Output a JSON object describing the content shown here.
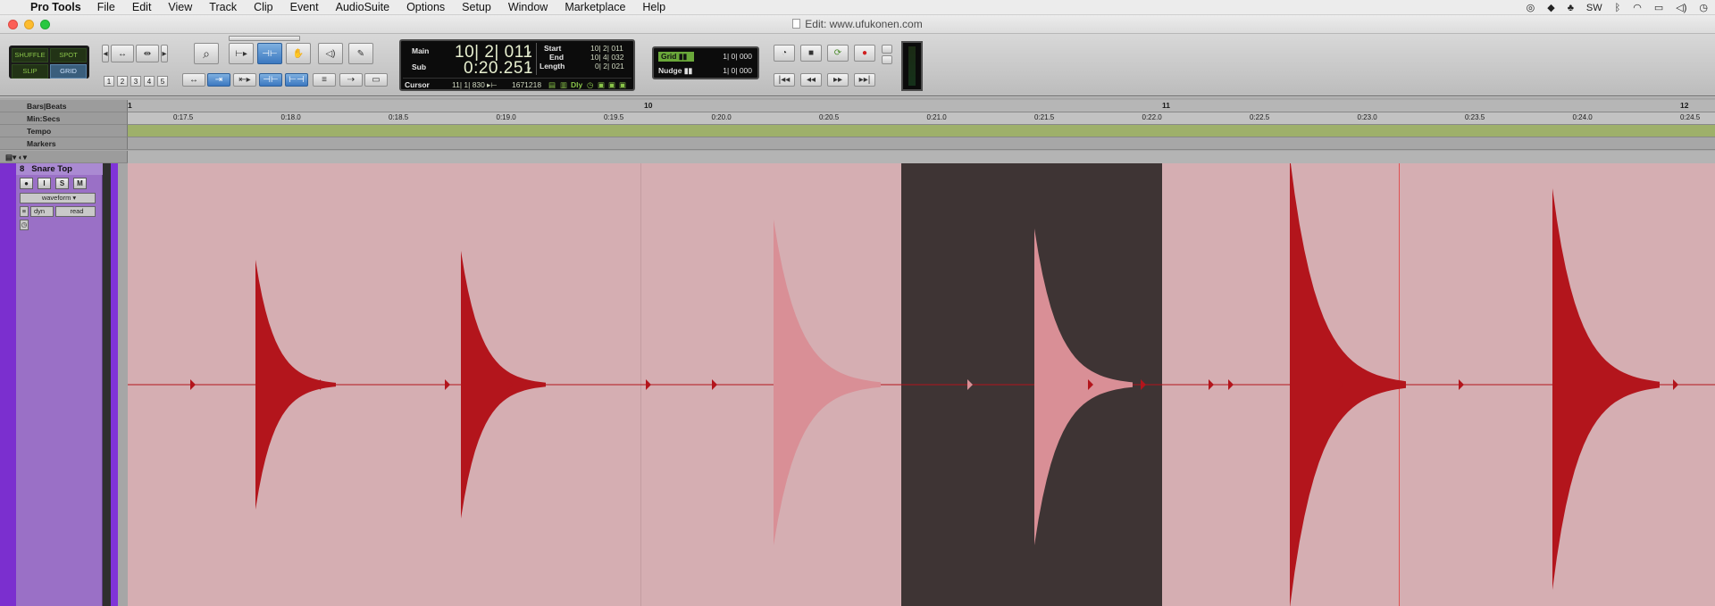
{
  "menubar": {
    "app_name": "Pro Tools",
    "items": [
      "File",
      "Edit",
      "View",
      "Track",
      "Clip",
      "Event",
      "AudioSuite",
      "Options",
      "Setup",
      "Window",
      "Marketplace",
      "Help"
    ],
    "status_text": "SW"
  },
  "window": {
    "title": "Edit: www.ufukonen.com"
  },
  "modes": {
    "shuffle": "SHUFFLE",
    "spot": "SPOT",
    "slip": "SLIP",
    "grid": "GRID"
  },
  "zoom_presets": [
    "1",
    "2",
    "3",
    "4",
    "5"
  ],
  "counter": {
    "main_label": "Main",
    "main_value": "10| 2| 011",
    "sub_label": "Sub",
    "sub_value": "0:20.251",
    "start_label": "Start",
    "start_value": "10| 2| 011",
    "end_label": "End",
    "end_value": "10| 4| 032",
    "length_label": "Length",
    "length_value": "0| 2| 021",
    "cursor_label": "Cursor",
    "cursor_value": "11| 1| 830",
    "sample_value": "1671218",
    "dly_label": "Dly"
  },
  "grid": {
    "grid_label": "Grid",
    "grid_value": "1| 0| 000",
    "nudge_label": "Nudge",
    "nudge_value": "1| 0| 000"
  },
  "rulers": {
    "bars_label": "Bars|Beats",
    "mins_label": "Min:Secs",
    "tempo_label": "Tempo",
    "markers_label": "Markers",
    "bar_marks": [
      "1",
      "10",
      "11",
      "12"
    ],
    "time_marks": [
      "0:17.5",
      "0:18.0",
      "0:18.5",
      "0:19.0",
      "0:19.5",
      "0:20.0",
      "0:20.5",
      "0:21.0",
      "0:21.5",
      "0:22.0",
      "0:22.5",
      "0:23.0",
      "0:23.5",
      "0:24.0",
      "0:24.5"
    ]
  },
  "track": {
    "number": "8",
    "name": "Snare Top",
    "view": "waveform",
    "automation_type": "dyn",
    "automation_mode": "read",
    "solo": "S",
    "mute": "M"
  },
  "colors": {
    "track": "#7b2fcf",
    "clip_bg": "#d5aeb2",
    "waveform": "#b3151c",
    "selection": "#3e3434"
  }
}
